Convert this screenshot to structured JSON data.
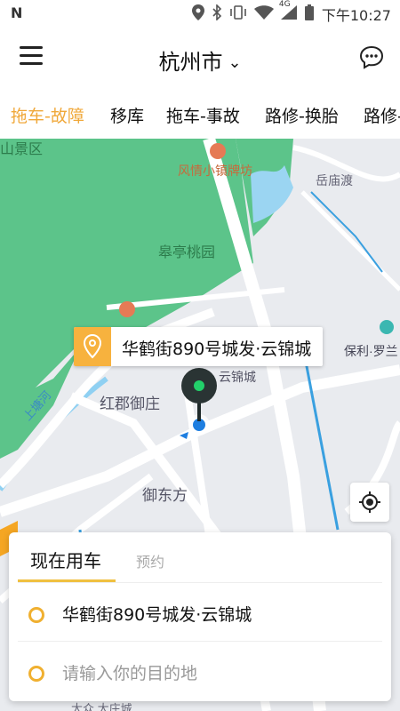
{
  "status": {
    "time": "下午10:27",
    "network": "4G",
    "carrier_logo": "N"
  },
  "header": {
    "city": "杭州市",
    "menu_icon": "hamburger-icon",
    "message_icon": "chat-bubble-icon"
  },
  "tabs": [
    {
      "label": "拖车-故障",
      "active": true
    },
    {
      "label": "移库"
    },
    {
      "label": "拖车-事故"
    },
    {
      "label": "路修-换胎"
    },
    {
      "label": "路修-"
    }
  ],
  "map": {
    "labels": {
      "park_top_left": "山景区",
      "poi_fengqing": "风情小镇牌坊",
      "yuemiao": "岳庙渡",
      "gaoting": "皋亭桃园",
      "baoli": "保利·罗兰",
      "yunjin": "云锦城",
      "hongjun": "红郡御庄",
      "yudongfang": "御东方",
      "river": "上塘河",
      "bottom": "大众 大庄城"
    },
    "location_card": "华鹤街890号城发·云锦城"
  },
  "panel": {
    "tab_now": "现在用车",
    "tab_reserve": "预约",
    "origin": "华鹤街890号城发·云锦城",
    "destination_placeholder": "请输入你的目的地"
  },
  "colors": {
    "accent": "#f0a83a",
    "park_green": "#5cc48a",
    "road_white": "#ffffff",
    "map_bg": "#e9ebef"
  }
}
